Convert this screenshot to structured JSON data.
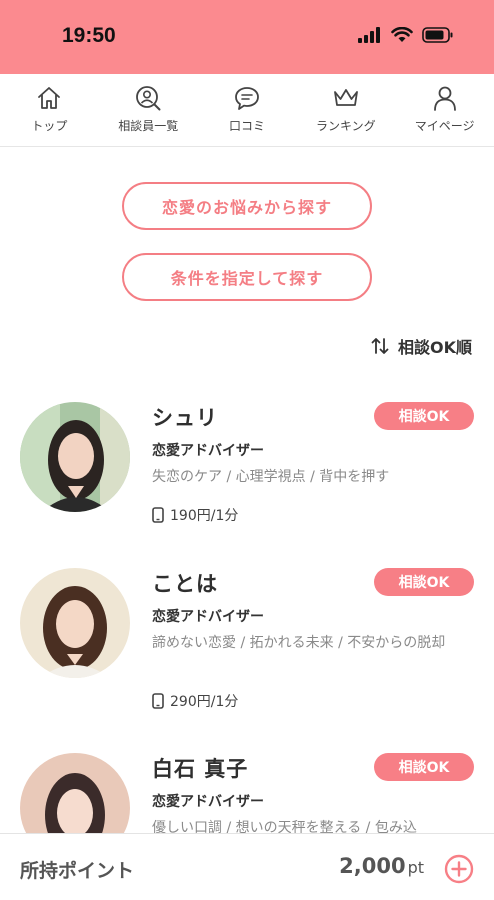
{
  "status_bar": {
    "time": "19:50"
  },
  "nav": {
    "items": [
      {
        "label": "トップ",
        "icon": "home-icon"
      },
      {
        "label": "相談員一覧",
        "icon": "person-search-icon"
      },
      {
        "label": "口コミ",
        "icon": "chat-bubble-icon"
      },
      {
        "label": "ランキング",
        "icon": "crown-icon"
      },
      {
        "label": "マイページ",
        "icon": "user-icon"
      }
    ]
  },
  "search": {
    "by_worry": "恋愛のお悩みから探す",
    "by_condition": "条件を指定して探す"
  },
  "sort": {
    "label": "相談OK順"
  },
  "counselors": [
    {
      "name": "シュリ",
      "status": "相談OK",
      "role": "恋愛アドバイザー",
      "tags": "失恋のケア / 心理学視点 / 背中を押す",
      "price": "190円/1分"
    },
    {
      "name": "ことは",
      "status": "相談OK",
      "role": "恋愛アドバイザー",
      "tags": "諦めない恋愛 / 拓かれる未来 / 不安からの脱却",
      "price": "290円/1分"
    },
    {
      "name": "白石 真子",
      "status": "相談OK",
      "role": "恋愛アドバイザー",
      "tags": "優しい口調 / 想いの天秤を整える / 包み込",
      "price": ""
    }
  ],
  "footer": {
    "points_label": "所持ポイント",
    "points_value": "2,000",
    "points_unit": "pt"
  },
  "colors": {
    "accent": "#f77f86",
    "status_bar": "#fb8a8f"
  }
}
